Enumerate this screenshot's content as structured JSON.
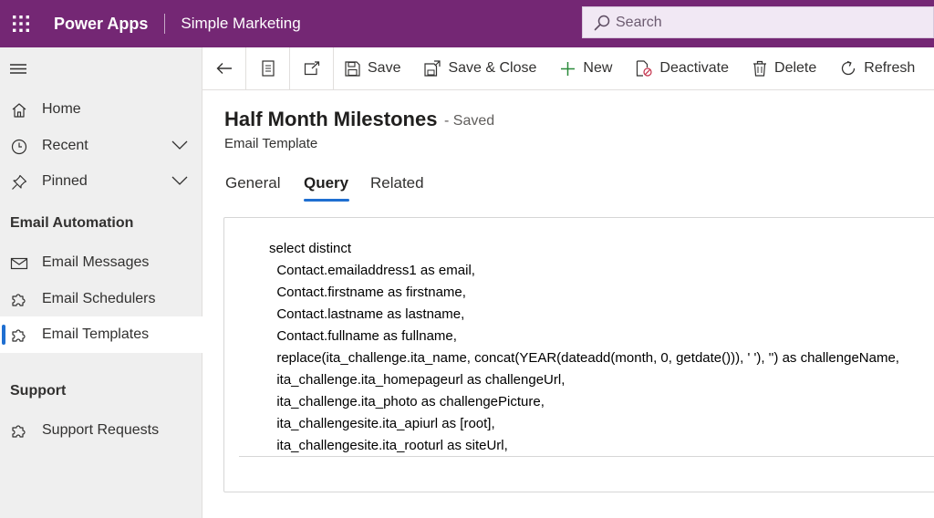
{
  "header": {
    "app_name": "Power Apps",
    "environment": "Simple Marketing",
    "search_placeholder": "Search"
  },
  "sidebar": {
    "items": [
      {
        "label": "Home",
        "icon": "home-icon"
      },
      {
        "label": "Recent",
        "icon": "clock-icon",
        "expandable": true
      },
      {
        "label": "Pinned",
        "icon": "pin-icon",
        "expandable": true
      }
    ],
    "sections": [
      {
        "title": "Email Automation",
        "items": [
          {
            "label": "Email Messages",
            "icon": "mail-icon"
          },
          {
            "label": "Email Schedulers",
            "icon": "puzzle-icon"
          },
          {
            "label": "Email Templates",
            "icon": "puzzle-icon",
            "selected": true
          }
        ]
      },
      {
        "title": "Support",
        "items": [
          {
            "label": "Support Requests",
            "icon": "puzzle-icon"
          }
        ]
      }
    ]
  },
  "commands": {
    "save": "Save",
    "save_close": "Save & Close",
    "new": "New",
    "deactivate": "Deactivate",
    "delete": "Delete",
    "refresh": "Refresh"
  },
  "form": {
    "title": "Half Month Milestones",
    "status": "- Saved",
    "entity": "Email Template",
    "tabs": [
      "General",
      "Query",
      "Related"
    ],
    "active_tab": "Query"
  },
  "query_lines": [
    "select distinct",
    "  Contact.emailaddress1 as email,",
    "  Contact.firstname as firstname,",
    "  Contact.lastname as lastname,",
    "  Contact.fullname as fullname,",
    "  replace(ita_challenge.ita_name, concat(YEAR(dateadd(month, 0, getdate())), ' '), '') as challengeName,",
    "  ita_challenge.ita_homepageurl as challengeUrl,",
    "  ita_challenge.ita_photo as challengePicture,",
    "  ita_challengesite.ita_apiurl as [root],",
    "  ita_challengesite.ita_rooturl as siteUrl,"
  ],
  "colors": {
    "brand": "#742774",
    "accent": "#1f6fd1",
    "sidebar_bg": "#efefef"
  }
}
